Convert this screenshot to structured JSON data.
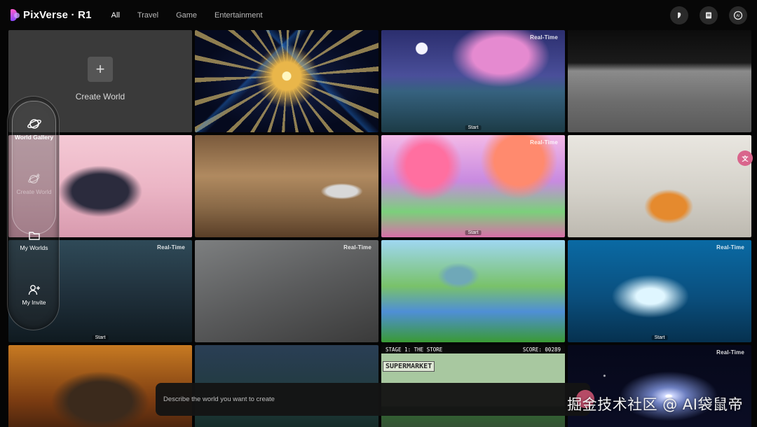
{
  "app": {
    "name": "PixVerse · R1"
  },
  "nav": {
    "tabs": [
      "All",
      "Travel",
      "Game",
      "Entertainment"
    ],
    "active": "All"
  },
  "create": {
    "label": "Create World"
  },
  "tiles": {
    "realtime": "Real-Time",
    "start": "Start"
  },
  "pixel_game": {
    "stage": "STAGE 1: THE STORE",
    "score": "SCORE: 00289",
    "sign": "SUPERMARKET"
  },
  "sidebar": {
    "items": [
      {
        "label": "World Gallery"
      },
      {
        "label": "Create World"
      },
      {
        "label": "My Worlds"
      },
      {
        "label": "My Invite"
      }
    ]
  },
  "prompt": {
    "placeholder": "Describe the world you want to create"
  },
  "watermark": "掘金技术社区 @ AI袋鼠帝",
  "colors": {
    "accent": "#e05a7a",
    "background": "#050505"
  }
}
